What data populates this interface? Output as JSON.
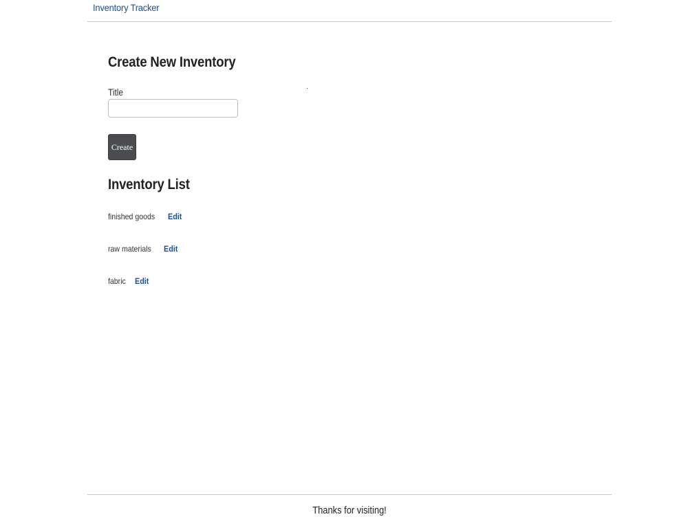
{
  "navbar": {
    "brand": "Inventory Tracker"
  },
  "create_form": {
    "heading": "Create New Inventory",
    "title_label": "Title",
    "title_value": "",
    "title_placeholder": "",
    "create_label": "Create"
  },
  "inventory_list": {
    "heading": "Inventory List",
    "edit_label": "Edit",
    "items": [
      {
        "title": "finished goods",
        "edit": "Edit"
      },
      {
        "title": "raw materials",
        "edit": "Edit"
      },
      {
        "title": "fabric",
        "edit": "Edit"
      }
    ]
  },
  "footer": {
    "text": "Thanks for visiting!"
  },
  "colors": {
    "link": "#1a4f9c",
    "button": "#4a4c4f",
    "divider": "#c8c8c8"
  }
}
